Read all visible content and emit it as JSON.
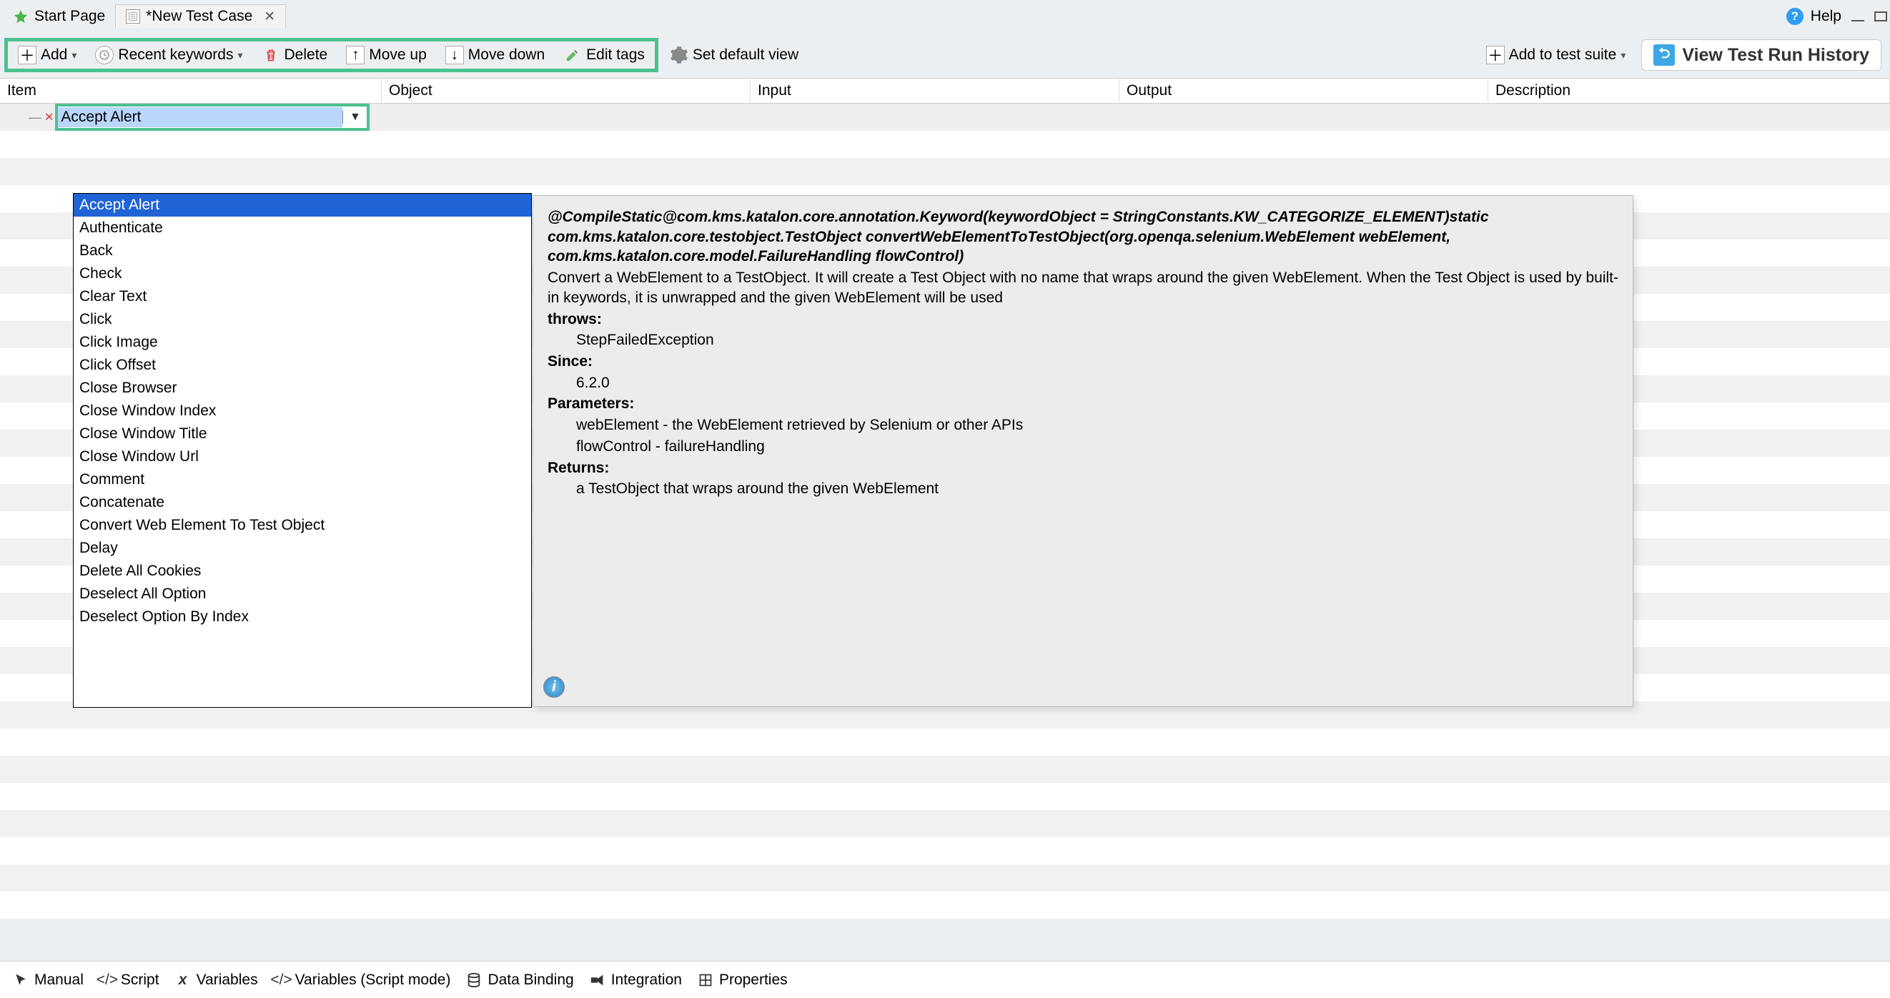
{
  "tabs": {
    "start_page": "Start Page",
    "test_case": "*New Test Case"
  },
  "help_label": "Help",
  "toolbar": {
    "add": "Add",
    "recent": "Recent keywords",
    "delete": "Delete",
    "moveup": "Move up",
    "movedown": "Move down",
    "edittags": "Edit tags",
    "setdefault": "Set default view",
    "addsuite": "Add to test suite",
    "viewhistory": "View Test Run History"
  },
  "columns": {
    "item": "Item",
    "object": "Object",
    "input": "Input",
    "output": "Output",
    "description": "Description"
  },
  "editor": {
    "current_value": "Accept Alert"
  },
  "keywords": [
    "Accept Alert",
    "Authenticate",
    "Back",
    "Check",
    "Clear Text",
    "Click",
    "Click Image",
    "Click Offset",
    "Close Browser",
    "Close Window Index",
    "Close Window Title",
    "Close Window Url",
    "Comment",
    "Concatenate",
    "Convert Web Element To Test Object",
    "Delay",
    "Delete All Cookies",
    "Deselect All Option",
    "Deselect Option By Index"
  ],
  "doc": {
    "sig1": "@CompileStatic@com.kms.katalon.core.annotation.Keyword(keywordObject = StringConstants.KW_CATEGORIZE_ELEMENT)static com.kms.katalon.core.testobject.TestObject convertWebElementToTestObject(org.openqa.selenium.WebElement webElement, com.kms.katalon.core.model.FailureHandling flowControl)",
    "body": "Convert a WebElement to a TestObject. It will create a Test Object with no name that wraps around the given WebElement. When the Test Object is used by built-in keywords, it is unwrapped and the given WebElement will be used",
    "throws_h": "throws:",
    "throws_v": "StepFailedException",
    "since_h": "Since:",
    "since_v": "6.2.0",
    "params_h": "Parameters:",
    "param1": "webElement - the WebElement retrieved by Selenium or other APIs",
    "param2": "flowControl - failureHandling",
    "returns_h": "Returns:",
    "returns_v": "a TestObject that wraps around the given WebElement"
  },
  "bottom_tabs": {
    "manual": "Manual",
    "script": "Script",
    "variables": "Variables",
    "variables_sm": "Variables (Script mode)",
    "databinding": "Data Binding",
    "integration": "Integration",
    "properties": "Properties"
  }
}
